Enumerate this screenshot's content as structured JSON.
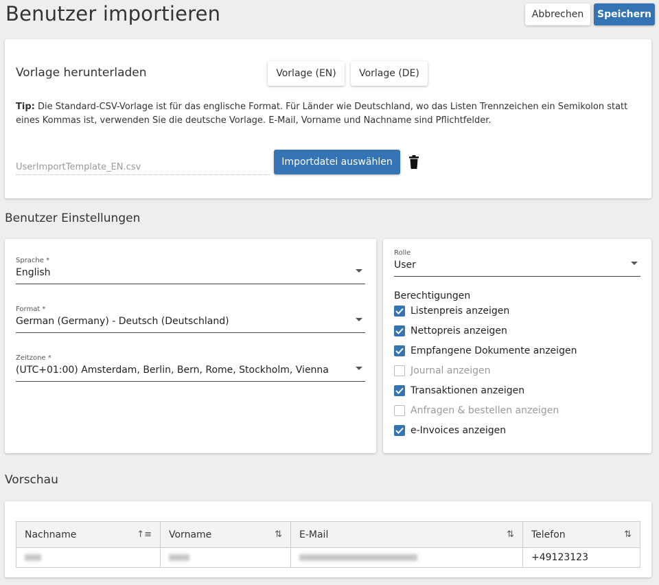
{
  "header": {
    "title": "Benutzer importieren",
    "cancel_label": "Abbrechen",
    "save_label": "Speichern"
  },
  "template_section": {
    "heading": "Vorlage herunterladen",
    "btn_en": "Vorlage (EN)",
    "btn_de": "Vorlage (DE)",
    "tip_bold": "Tip:",
    "tip_text": " Die Standard-CSV-Vorlage ist für das englische Format. Für Länder wie Deutschland, wo das Listen Trennzeichen ein Semikolon statt eines Kommas ist, verwenden Sie die deutsche Vorlage. E-Mail, Vorname und Nachname sind Pflichtfelder.",
    "file_placeholder": "UserImportTemplate_EN.csv",
    "import_button": "Importdatei auswählen",
    "delete_icon": "trash-icon"
  },
  "settings": {
    "heading": "Benutzer Einstellungen",
    "language": {
      "label": "Sprache *",
      "value": "English"
    },
    "format": {
      "label": "Format *",
      "value": "German (Germany) - Deutsch (Deutschland)"
    },
    "timezone": {
      "label": "Zeitzone *",
      "value": "(UTC+01:00) Amsterdam, Berlin, Bern, Rome, Stockholm, Vienna"
    }
  },
  "role": {
    "label": "Rolle",
    "value": "User",
    "permissions_heading": "Berechtigungen",
    "permissions": [
      {
        "label": "Listenpreis anzeigen",
        "checked": true
      },
      {
        "label": "Nettopreis anzeigen",
        "checked": true
      },
      {
        "label": "Empfangene Dokumente anzeigen",
        "checked": true
      },
      {
        "label": "Journal anzeigen",
        "checked": false
      },
      {
        "label": "Transaktionen anzeigen",
        "checked": true
      },
      {
        "label": "Anfragen & bestellen anzeigen",
        "checked": false
      },
      {
        "label": "e-Invoices anzeigen",
        "checked": true
      }
    ]
  },
  "preview": {
    "heading": "Vorschau",
    "columns": [
      "Nachname",
      "Vorname",
      "E-Mail",
      "Telefon"
    ],
    "rows": [
      {
        "phone": "+49123123"
      }
    ]
  },
  "colors": {
    "primary": "#3474b5",
    "background": "#eeeeee"
  }
}
